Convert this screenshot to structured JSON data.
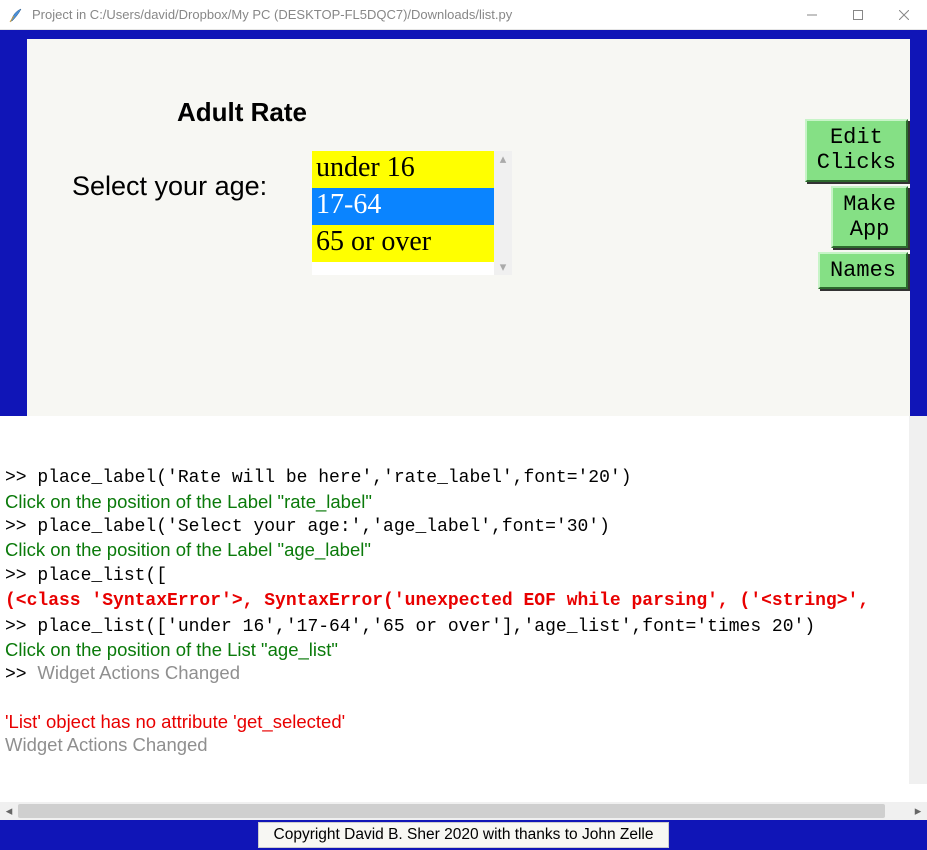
{
  "window": {
    "title": "Project in C:/Users/david/Dropbox/My PC (DESKTOP-FL5DQC7)/Downloads/list.py"
  },
  "canvas": {
    "rate_label": "Adult Rate",
    "age_label": "Select your age:",
    "age_list": {
      "items": [
        "under 16",
        "17-64",
        "65 or over"
      ],
      "selected_index": 1
    },
    "buttons": {
      "edit_clicks": "Edit\nClicks",
      "make_app": "Make\nApp",
      "names": "Names"
    }
  },
  "console": {
    "lines": [
      {
        "segs": [
          {
            "cls": "mono",
            "text": ">> place_label('Rate will be here','rate_label',font='20')"
          }
        ]
      },
      {
        "segs": [
          {
            "cls": "green",
            "text": "Click on the position of the Label \"rate_label\""
          }
        ]
      },
      {
        "segs": [
          {
            "cls": "mono",
            "text": ">> place_label('Select your age:','age_label',font='30')"
          }
        ]
      },
      {
        "segs": [
          {
            "cls": "green",
            "text": "Click on the position of the Label \"age_label\""
          }
        ]
      },
      {
        "segs": [
          {
            "cls": "mono",
            "text": ">> place_list(["
          }
        ]
      },
      {
        "segs": [
          {
            "cls": "monob redb",
            "text": "(<class 'SyntaxError'>, SyntaxError('unexpected EOF while parsing', ('<string>',"
          }
        ]
      },
      {
        "segs": [
          {
            "cls": "mono",
            "text": ">> place_list(['under 16','17-64','65 or over'],'age_list',font='times 20')"
          }
        ]
      },
      {
        "segs": [
          {
            "cls": "green",
            "text": "Click on the position of the List \"age_list\""
          }
        ]
      },
      {
        "segs": [
          {
            "cls": "mono",
            "text": ">> "
          },
          {
            "cls": "gray",
            "text": "Widget Actions Changed"
          }
        ]
      },
      {
        "segs": [
          {
            "cls": "",
            "text": " "
          }
        ]
      },
      {
        "segs": [
          {
            "cls": "red",
            "text": "'List' object has no attribute 'get_selected'"
          }
        ]
      },
      {
        "segs": [
          {
            "cls": "gray",
            "text": "Widget Actions Changed"
          }
        ]
      }
    ]
  },
  "footer": {
    "text": "Copyright David B. Sher 2020 with thanks to John Zelle"
  }
}
